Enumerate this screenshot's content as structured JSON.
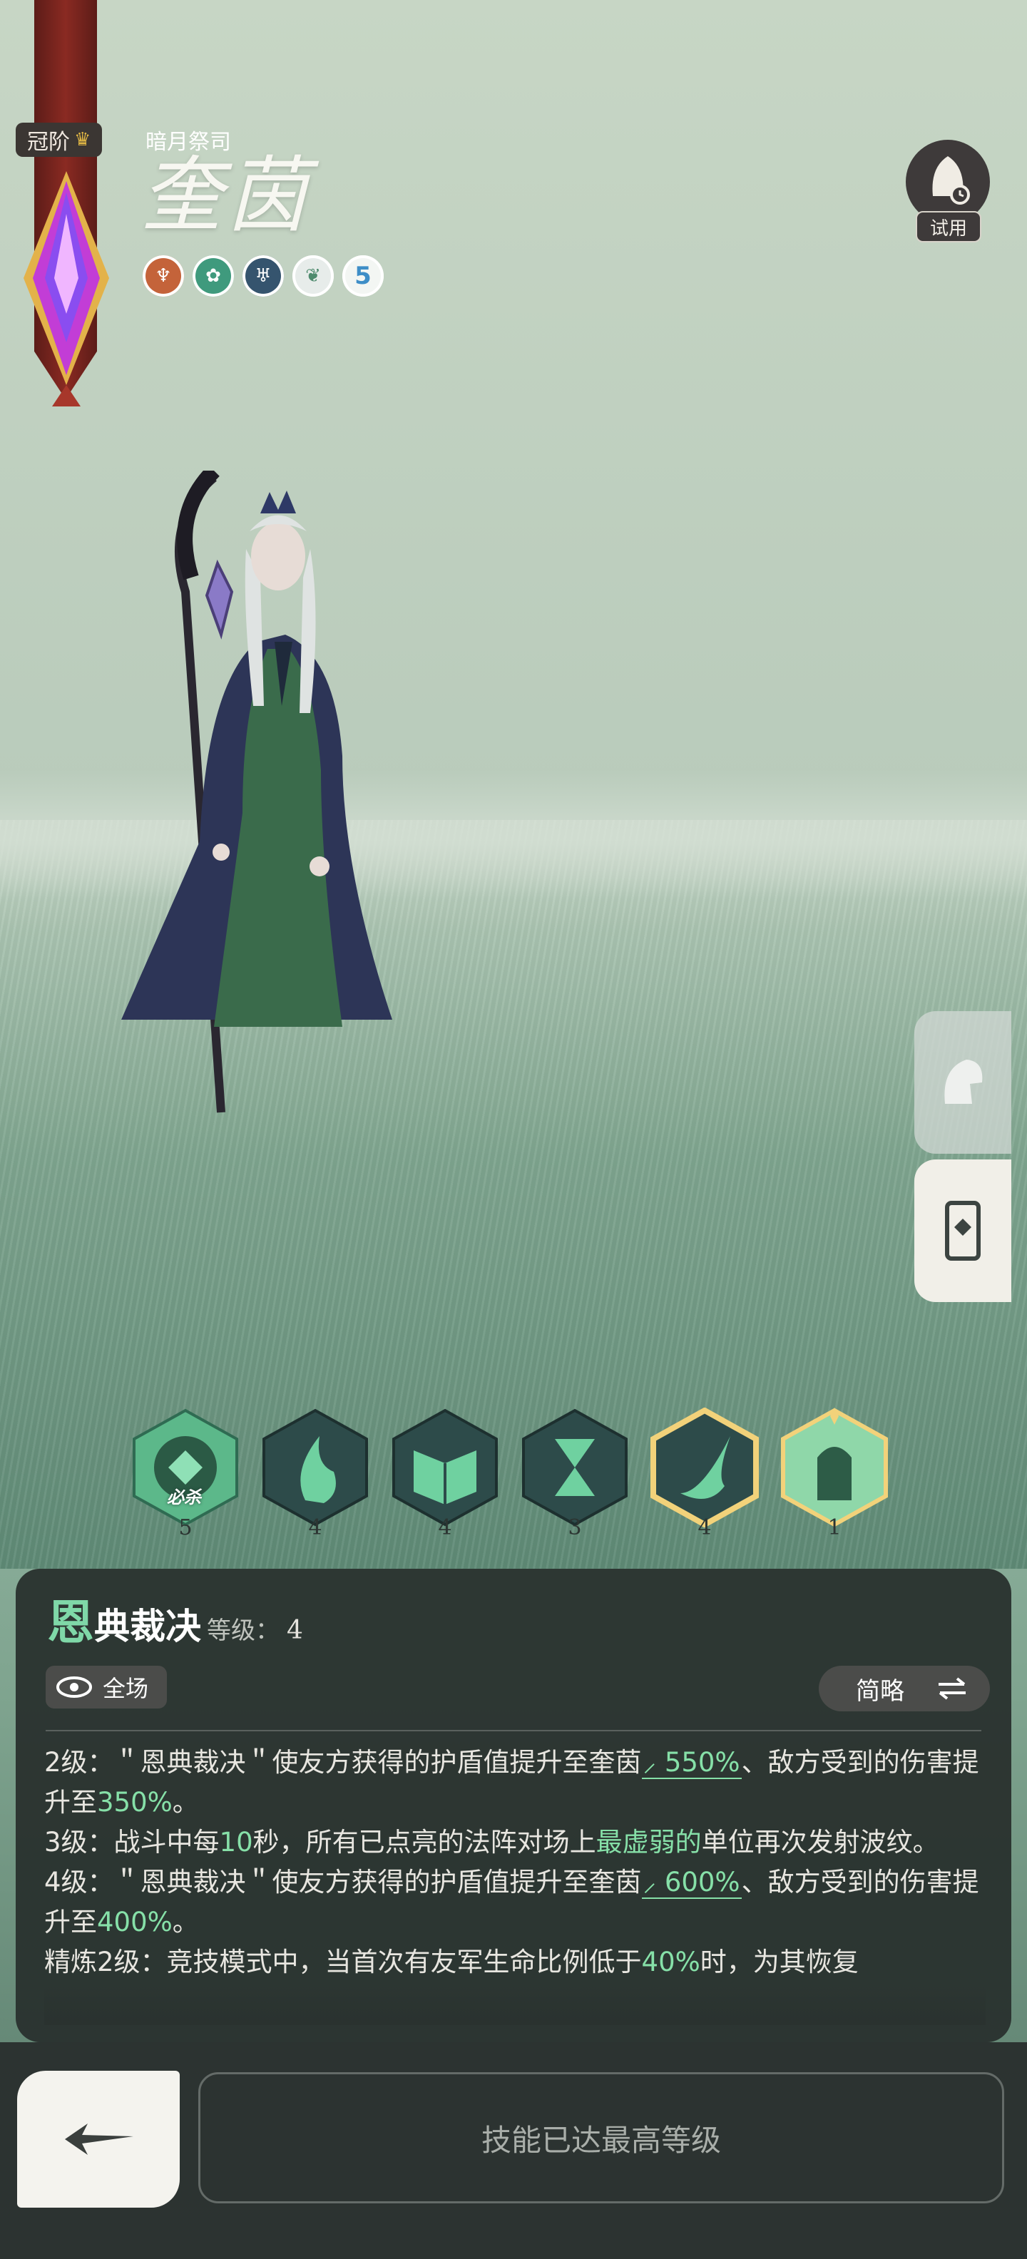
{
  "hero": {
    "rank_tag": "冠阶",
    "subtitle": "暗月祭司",
    "name": "奎茵",
    "attributes": [
      "fire-icon",
      "nature-icon",
      "crest-icon",
      "leaf-icon"
    ],
    "star_level": "5"
  },
  "trial": {
    "label": "试用"
  },
  "skills": [
    {
      "icon": "seal-icon",
      "level": "5",
      "tag": "必杀"
    },
    {
      "icon": "flame-icon",
      "level": "4"
    },
    {
      "icon": "book-icon",
      "level": "4"
    },
    {
      "icon": "hourglass-icon",
      "level": "3"
    },
    {
      "icon": "comet-icon",
      "level": "4",
      "selected": true
    },
    {
      "icon": "knight-icon",
      "level": "1"
    }
  ],
  "detail": {
    "title_first": "恩",
    "title_rest": "典裁决",
    "level_label": "等级：",
    "level_value": "4",
    "range": "全场",
    "toggle": "简略",
    "lines": [
      {
        "prefix": "2级：＂恩典裁决＂使友方获得的护盾值提升至奎茵",
        "val1": "550%",
        "mid": "、敌方受到的伤害提升至",
        "val2": "350%",
        "suffix": "。"
      },
      {
        "prefix": "3级：战斗中每",
        "val1": "10",
        "mid": "秒，所有已点亮的法阵对场上",
        "val2": "最虚弱的",
        "suffix": "单位再次发射波纹。"
      },
      {
        "prefix": "4级：＂恩典裁决＂使友方获得的护盾值提升至奎茵",
        "val1": "600%",
        "mid": "、敌方受到的伤害提升至",
        "val2": "400%",
        "suffix": "。"
      },
      {
        "prefix": "精炼2级：竞技模式中，当首次有友军生命比例低于",
        "val1": "40%",
        "mid": "时，为其恢复",
        "val2": "",
        "suffix": ""
      }
    ]
  },
  "footer": {
    "max_label": "技能已达最高等级"
  },
  "colors": {
    "highlight": "#86e0a8",
    "panel": "#2a322f",
    "selected_skill_border": "#f2d27a"
  }
}
